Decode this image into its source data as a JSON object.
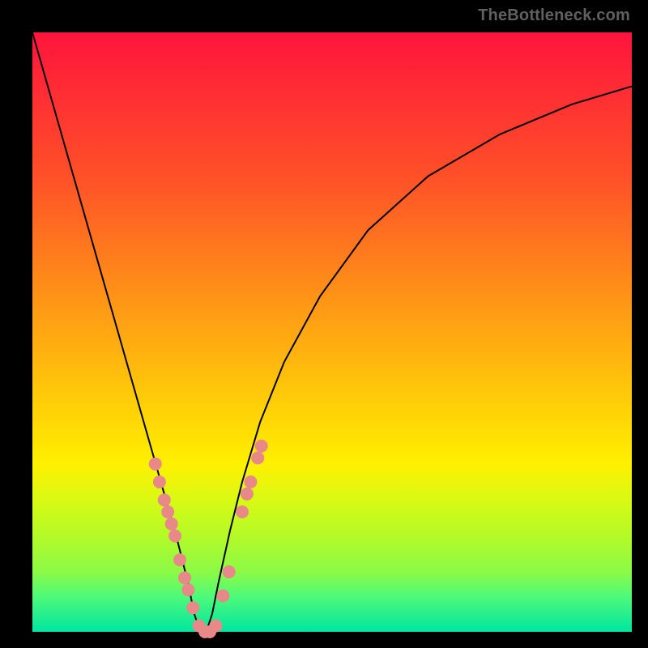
{
  "watermark": "TheBottleneck.com",
  "colors": {
    "curve": "#000000",
    "marker": "#e98888",
    "gradient_top": "#ff143c",
    "gradient_bottom": "#00e6a0"
  },
  "chart_data": {
    "type": "line",
    "title": "",
    "xlabel": "",
    "ylabel": "",
    "xlim": [
      0,
      100
    ],
    "ylim": [
      0,
      100
    ],
    "x_minimum": 28,
    "curve": {
      "x": [
        0,
        4,
        8,
        12,
        16,
        18,
        20,
        22,
        24,
        26,
        27,
        28,
        29,
        30,
        31,
        33,
        35,
        38,
        42,
        48,
        56,
        66,
        78,
        90,
        100
      ],
      "y": [
        100,
        86,
        72,
        58,
        44,
        37,
        30,
        23,
        16,
        8,
        3,
        0,
        0,
        3,
        8,
        17,
        25,
        35,
        45,
        56,
        67,
        76,
        83,
        88,
        91
      ]
    },
    "markers": [
      {
        "x": 20.5,
        "y": 28
      },
      {
        "x": 21.2,
        "y": 25
      },
      {
        "x": 22.0,
        "y": 22
      },
      {
        "x": 22.6,
        "y": 20
      },
      {
        "x": 23.2,
        "y": 18
      },
      {
        "x": 23.8,
        "y": 16
      },
      {
        "x": 24.6,
        "y": 12
      },
      {
        "x": 25.4,
        "y": 9
      },
      {
        "x": 26.0,
        "y": 7
      },
      {
        "x": 26.8,
        "y": 4
      },
      {
        "x": 27.8,
        "y": 1
      },
      {
        "x": 28.8,
        "y": 0
      },
      {
        "x": 29.6,
        "y": 0
      },
      {
        "x": 30.6,
        "y": 1
      },
      {
        "x": 31.8,
        "y": 6
      },
      {
        "x": 32.8,
        "y": 10
      },
      {
        "x": 35.0,
        "y": 20
      },
      {
        "x": 35.8,
        "y": 23
      },
      {
        "x": 36.4,
        "y": 25
      },
      {
        "x": 37.6,
        "y": 29
      },
      {
        "x": 38.2,
        "y": 31
      }
    ]
  }
}
